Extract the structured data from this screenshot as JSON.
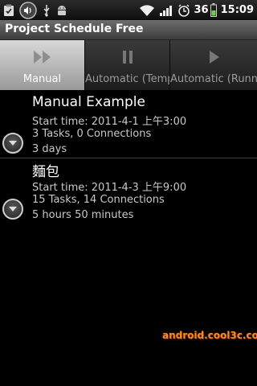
{
  "status_bar": {
    "icons_left": [
      "clipboard-check-icon",
      "sound-icon",
      "usb-icon",
      "android-debug-icon"
    ],
    "icons_right": [
      "wifi-icon",
      "signal-icon",
      "alarm-icon"
    ],
    "battery_level": "36",
    "time": "15:09"
  },
  "app": {
    "title": "Project Schedule Free"
  },
  "tabs": [
    {
      "label": "Manual",
      "icon": "fast-forward-icon",
      "selected": true
    },
    {
      "label": "Automatic (Temp",
      "icon": "pause-icon",
      "selected": false
    },
    {
      "label": "Automatic (Runni",
      "icon": "play-icon",
      "selected": false
    }
  ],
  "projects": [
    {
      "name": "Manual Example",
      "start_time": "Start time: 2011-4-1 上午3:00",
      "summary": "3 Tasks, 0 Connections",
      "duration": "3 days"
    },
    {
      "name": "麵包",
      "start_time": "Start time: 2011-4-3 上午9:00",
      "summary": "15 Tasks, 14 Connections",
      "duration": "5 hours 50 minutes"
    }
  ],
  "watermark": "android.cool3c.com",
  "colors": {
    "selected_tab": "#c8c8c8",
    "watermark": "#ff8a1c",
    "background": "#000000"
  }
}
